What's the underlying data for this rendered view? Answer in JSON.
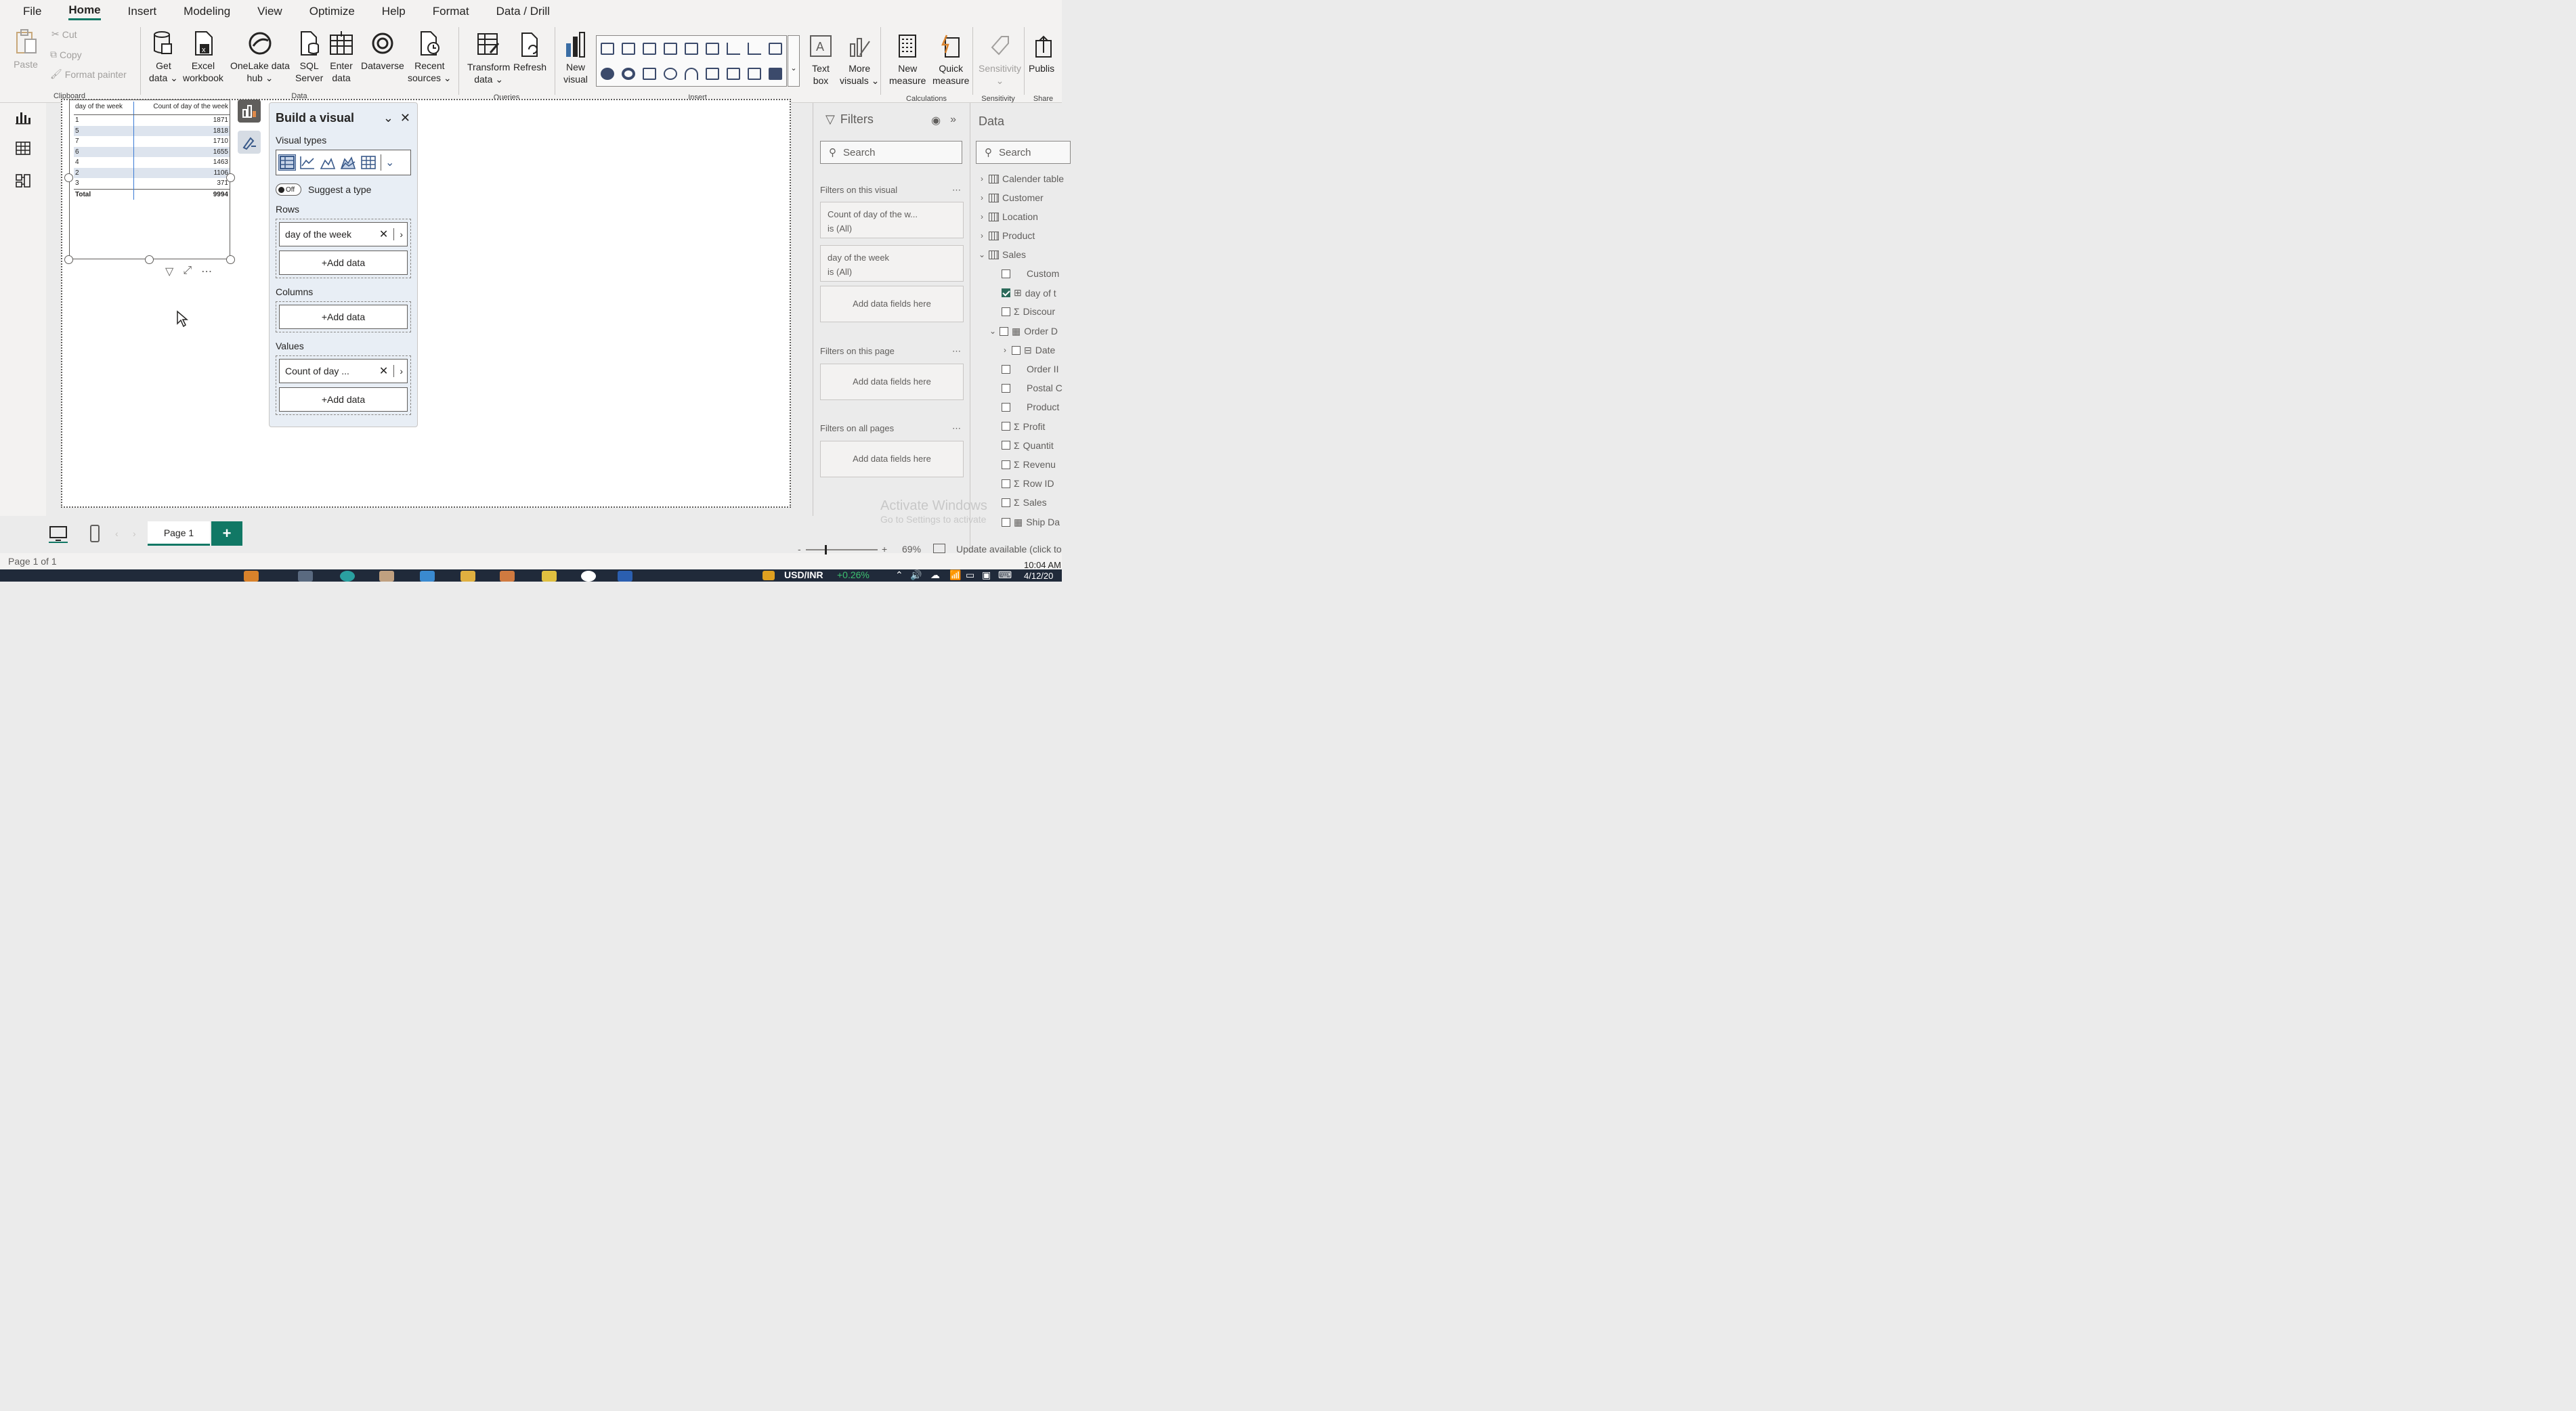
{
  "menu": [
    "File",
    "Home",
    "Insert",
    "Modeling",
    "View",
    "Optimize",
    "Help",
    "Format",
    "Data / Drill"
  ],
  "menu_active": "Home",
  "ribbon": {
    "clipboard": {
      "paste": "Paste",
      "cut": "Cut",
      "copy": "Copy",
      "format_painter": "Format painter",
      "label": "Clipboard"
    },
    "data": {
      "get_data": [
        "Get",
        "data ⌄"
      ],
      "excel": [
        "Excel",
        "workbook"
      ],
      "onelake": [
        "OneLake data",
        "hub ⌄"
      ],
      "sql": [
        "SQL",
        "Server"
      ],
      "enter": [
        "Enter",
        "data"
      ],
      "dataverse": [
        "Dataverse",
        ""
      ],
      "recent": [
        "Recent",
        "sources ⌄"
      ],
      "label": "Data"
    },
    "queries": {
      "transform": [
        "Transform",
        "data ⌄"
      ],
      "refresh": [
        "Refresh",
        ""
      ],
      "label": "Queries"
    },
    "insert": {
      "new_visual": [
        "New",
        "visual"
      ],
      "text_box": [
        "Text",
        "box"
      ],
      "more_visuals": [
        "More",
        "visuals ⌄"
      ],
      "label": "Insert"
    },
    "calculations": {
      "new_measure": [
        "New",
        "measure"
      ],
      "quick_measure": [
        "Quick",
        "measure"
      ],
      "label": "Calculations"
    },
    "sensitivity": {
      "btn": [
        "Sensitivity",
        "⌄"
      ],
      "label": "Sensitivity"
    },
    "share": {
      "btn": "Publis",
      "label": "Share"
    }
  },
  "table_visual": {
    "headers": [
      "day of the week",
      "Count of day of the week"
    ],
    "rows": [
      {
        "day": "1",
        "count": "1871"
      },
      {
        "day": "5",
        "count": "1818"
      },
      {
        "day": "7",
        "count": "1710"
      },
      {
        "day": "6",
        "count": "1655"
      },
      {
        "day": "4",
        "count": "1463"
      },
      {
        "day": "2",
        "count": "1106"
      },
      {
        "day": "3",
        "count": "371"
      }
    ],
    "total_label": "Total",
    "total_value": "9994"
  },
  "build_pane": {
    "title": "Build a visual",
    "visual_types_label": "Visual types",
    "suggest_toggle": "Off",
    "suggest_label": "Suggest a type",
    "rows_label": "Rows",
    "rows_field": "day of the week",
    "columns_label": "Columns",
    "values_label": "Values",
    "values_field": "Count of day ...",
    "add_data": "+Add data"
  },
  "filters": {
    "title": "Filters",
    "search_placeholder": "Search",
    "on_visual_label": "Filters on this visual",
    "card1_title": "Count of day of the w...",
    "card1_value": "is (All)",
    "card2_title": "day of the week",
    "card2_value": "is (All)",
    "add_fields": "Add data fields here",
    "on_page_label": "Filters on this page",
    "on_all_label": "Filters on all pages"
  },
  "data_pane": {
    "title": "Data",
    "search_placeholder": "Search",
    "tables": [
      "Calender table",
      "Customer",
      "Location",
      "Product"
    ],
    "sales_table": "Sales",
    "sales_fields": [
      {
        "label": "Custom",
        "icon": "",
        "checked": false
      },
      {
        "label": "day of t",
        "icon": "table",
        "checked": true
      },
      {
        "label": "Discour",
        "icon": "sigma",
        "checked": false
      },
      {
        "label": "Order D",
        "icon": "calendar",
        "checked": false
      },
      {
        "label": "Date",
        "icon": "hierarchy",
        "checked": false
      },
      {
        "label": "Order II",
        "icon": "",
        "checked": false
      },
      {
        "label": "Postal C",
        "icon": "",
        "checked": false
      },
      {
        "label": "Product",
        "icon": "",
        "checked": false
      },
      {
        "label": "Profit",
        "icon": "sigma",
        "checked": false
      },
      {
        "label": "Quantit",
        "icon": "sigma",
        "checked": false
      },
      {
        "label": "Revenu",
        "icon": "sigma",
        "checked": false
      },
      {
        "label": "Row ID",
        "icon": "sigma",
        "checked": false
      },
      {
        "label": "Sales",
        "icon": "sigma",
        "checked": false
      },
      {
        "label": "Ship Da",
        "icon": "calendar",
        "checked": false
      }
    ]
  },
  "pages": {
    "tab": "Page 1",
    "add": "+"
  },
  "status": {
    "page_count": "Page 1 of 1",
    "zoom": "69%",
    "update": "Update available (click to",
    "zoom_plus": "+",
    "zoom_minus": "-"
  },
  "watermark": {
    "line1": "Activate Windows",
    "line2": "Go to Settings to activate"
  },
  "taskbar": {
    "ticker": "USD/INR",
    "change": "+0.26%",
    "time": "10:04 AM",
    "date": "4/12/20"
  },
  "colors": {
    "accent": "#117865",
    "selected_row_band": "#dde4ee",
    "build_pane_bg": "#e8eef5"
  }
}
